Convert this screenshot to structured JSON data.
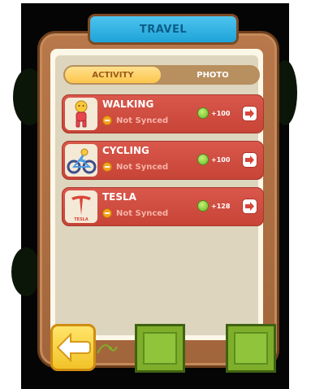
{
  "header": {
    "title": "TRAVEL"
  },
  "tabs": [
    {
      "label": "ACTIVITY",
      "active": true
    },
    {
      "label": "PHOTO",
      "active": false
    }
  ],
  "activities": [
    {
      "name": "WALKING",
      "status": "Not Synced",
      "reward": "+100",
      "icon": "walking-person-icon"
    },
    {
      "name": "CYCLING",
      "status": "Not Synced",
      "reward": "+100",
      "icon": "bicycle-icon"
    },
    {
      "name": "TESLA",
      "status": "Not Synced",
      "reward": "+128",
      "icon": "tesla-logo-icon",
      "logo_text": "TESLA"
    }
  ],
  "colors": {
    "row": "#d24c40",
    "tab_active": "#fcd36b",
    "title_bar": "#2fb3e4",
    "back_button": "#f9d443",
    "green_button": "#86b832"
  }
}
